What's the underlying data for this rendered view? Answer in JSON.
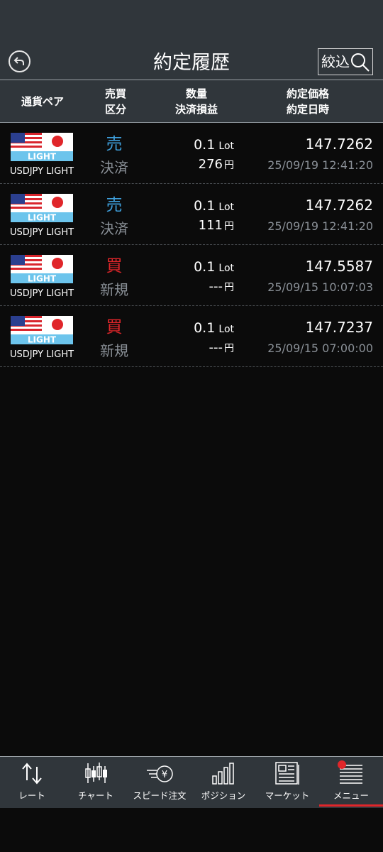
{
  "header": {
    "title": "約定履歴",
    "filter_label": "絞込"
  },
  "columns": {
    "pair": "通貨ペア",
    "side_line1": "売買",
    "side_line2": "区分",
    "qty_line1": "数量",
    "qty_line2": "決済損益",
    "price_line1": "約定価格",
    "price_line2": "約定日時"
  },
  "rows": [
    {
      "pair": "USDJPY LIGHT",
      "flag_label": "LIGHT",
      "side": "売",
      "side_type": "sell",
      "settle": "決済",
      "qty": "0.1",
      "qty_unit": "Lot",
      "pl": "276",
      "pl_unit": "円",
      "price": "147.7262",
      "datetime": "25/09/19 12:41:20"
    },
    {
      "pair": "USDJPY LIGHT",
      "flag_label": "LIGHT",
      "side": "売",
      "side_type": "sell",
      "settle": "決済",
      "qty": "0.1",
      "qty_unit": "Lot",
      "pl": "111",
      "pl_unit": "円",
      "price": "147.7262",
      "datetime": "25/09/19 12:41:20"
    },
    {
      "pair": "USDJPY LIGHT",
      "flag_label": "LIGHT",
      "side": "買",
      "side_type": "buy",
      "settle": "新規",
      "qty": "0.1",
      "qty_unit": "Lot",
      "pl": "---",
      "pl_unit": "円",
      "price": "147.5587",
      "datetime": "25/09/15 10:07:03"
    },
    {
      "pair": "USDJPY LIGHT",
      "flag_label": "LIGHT",
      "side": "買",
      "side_type": "buy",
      "settle": "新規",
      "qty": "0.1",
      "qty_unit": "Lot",
      "pl": "---",
      "pl_unit": "円",
      "price": "147.7237",
      "datetime": "25/09/15 07:00:00"
    }
  ],
  "nav": [
    {
      "label": "レート",
      "icon": "rate-arrows-icon"
    },
    {
      "label": "チャート",
      "icon": "candlestick-chart-icon"
    },
    {
      "label": "スピード注文",
      "icon": "speed-order-yen-icon"
    },
    {
      "label": "ポジション",
      "icon": "position-bars-icon"
    },
    {
      "label": "マーケット",
      "icon": "market-news-icon"
    },
    {
      "label": "メニュー",
      "icon": "menu-lines-icon"
    }
  ],
  "colors": {
    "sell": "#3e9fdc",
    "buy": "#e0262a",
    "header_bg": "#30363b",
    "accent": "#e0262a"
  }
}
